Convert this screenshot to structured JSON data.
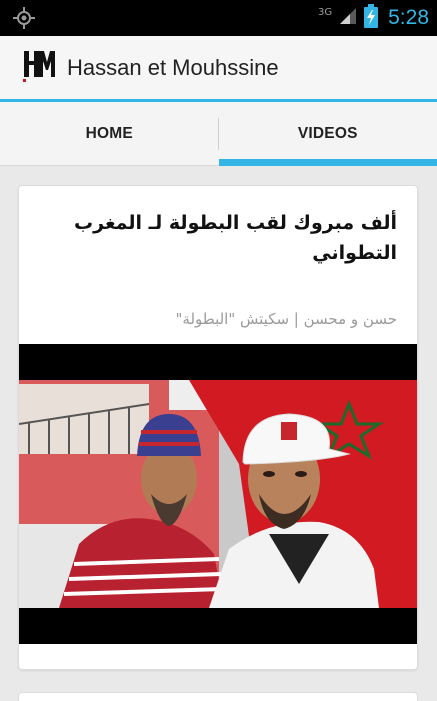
{
  "status_bar": {
    "left_icon": "gps-icon",
    "network": "3G",
    "signal_icon": "signal-icon",
    "battery_icon": "battery-charging-icon",
    "time": "5:28"
  },
  "app_bar": {
    "logo_icon": "hm-logo-icon",
    "title": "Hassan et Mouhssine"
  },
  "tabs": [
    {
      "label": "HOME",
      "selected": false
    },
    {
      "label": "VIDEOS",
      "selected": true
    }
  ],
  "cards": [
    {
      "title": "ألف مبروك لقب البطولة لـ المغرب التطواني",
      "subtitle": "حسن و محسن | سكيتش \"البطولة\"",
      "thumbnail": "video-thumbnail"
    }
  ],
  "colors": {
    "accent": "#33b5e5",
    "status_bar": "#000000",
    "title_text": "#222222",
    "subtitle_text": "#9a9a9a"
  }
}
